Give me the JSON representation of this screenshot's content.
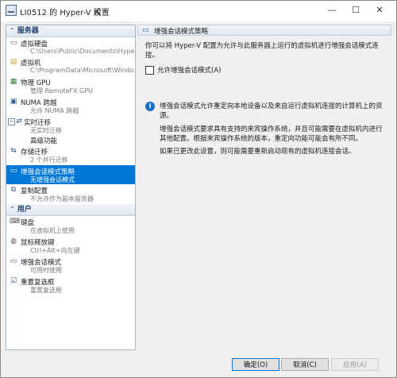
{
  "window": {
    "title": "LI0512 的 Hyper-V 设置",
    "minimize_glyph": "—",
    "maximize_glyph": "☐",
    "close_glyph": "✕"
  },
  "sidebar": {
    "server_header": "服务器",
    "user_header": "用户",
    "server_items": [
      {
        "main": "虚拟硬盘",
        "sub": "C:\\Users\\Public\\Documents\\Hyper-...",
        "icon": "disk-icon"
      },
      {
        "main": "虚拟机",
        "sub": "C:\\ProgramData\\Microsoft\\Windo...",
        "icon": "vm-folder-icon"
      },
      {
        "main": "物理 GPU",
        "sub": "管理 RemoteFX GPU",
        "icon": "gpu-icon"
      },
      {
        "main": "NUMA 跨越",
        "sub": "允许 NUMA 跨越",
        "icon": "numa-icon"
      },
      {
        "main": "实时迁移",
        "sub": "无实时迁移",
        "icon": "live-migration-icon"
      },
      {
        "main": "高级功能",
        "sub": "",
        "icon": ""
      },
      {
        "main": "存储迁移",
        "sub": "2 个并行迁移",
        "icon": "storage-migration-icon"
      },
      {
        "main": "增强会话模式策略",
        "sub": "无增强会话模式",
        "icon": "enhanced-session-icon"
      },
      {
        "main": "复制配置",
        "sub": "不允许作为副本服务器",
        "icon": "replication-icon"
      }
    ],
    "user_items": [
      {
        "main": "键盘",
        "sub": "在虚拟机上使用",
        "icon": "keyboard-icon"
      },
      {
        "main": "鼠标释放键",
        "sub": "Ctrl+Alt+向左键",
        "icon": "mouse-icon"
      },
      {
        "main": "增强会话模式",
        "sub": "可用时使用",
        "icon": "session-icon"
      },
      {
        "main": "重置复选框",
        "sub": "重置复选框",
        "icon": "reset-icon"
      }
    ]
  },
  "pane": {
    "header": "增强会话模式策略",
    "description": "你可以将 Hyper-V 配置为允许与此服务器上运行的虚拟机进行增强会话模式连接。",
    "checkbox_label": "允许增强会话模式(A)",
    "checkbox_checked": false,
    "info_glyph": "i",
    "info_1": "增强会话模式允许重定向本地设备以及来自运行虚拟机连接的计算机上的资源。",
    "info_2": "增强会话模式要求具有支持的来宾操作系统，并且可能需要在虚拟机内进行其他配置。根据来宾操作系统的版本，重定向功能可能会有所不同。",
    "info_3": "如果已更改此设置，则可能需要重新启动现有的虚拟机连接会话。"
  },
  "footer": {
    "ok": "确定(O)",
    "cancel": "取消(C)",
    "apply": "应用(A)"
  },
  "colors": {
    "selection": "#0078d7",
    "header_text": "#1f3d6b"
  }
}
